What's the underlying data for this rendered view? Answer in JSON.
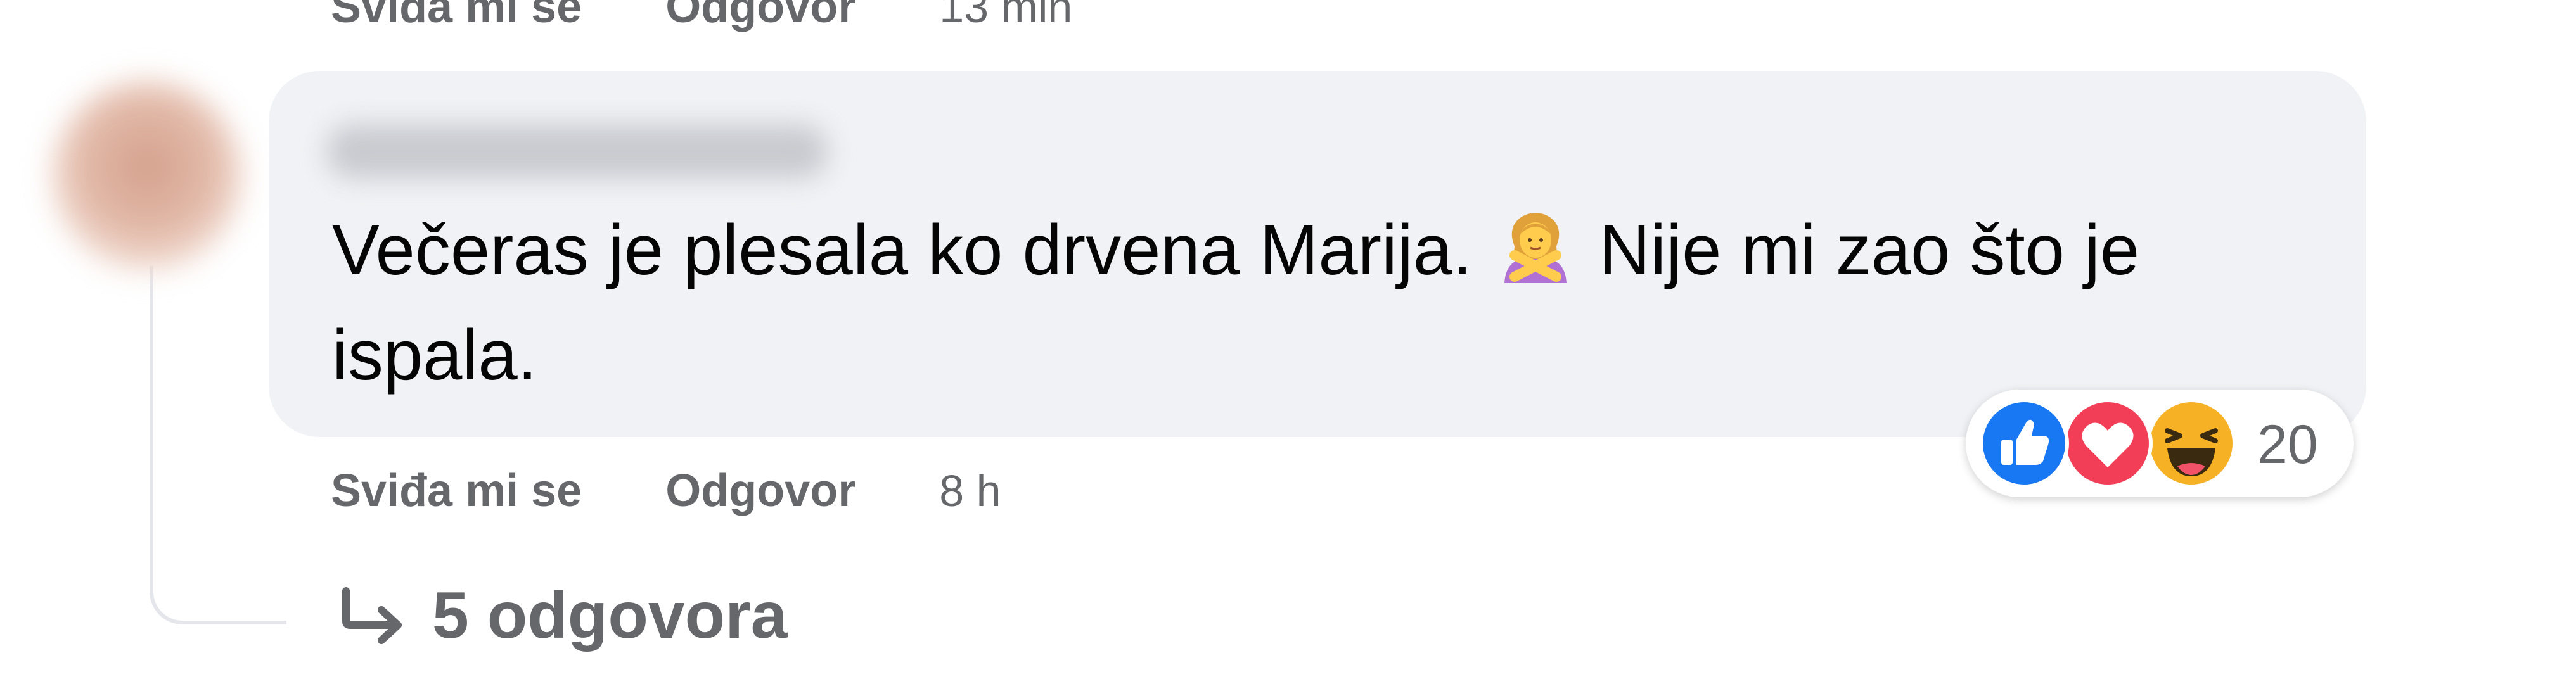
{
  "top_actions": {
    "like_label": "Sviđa mi se",
    "reply_label": "Odgovor",
    "time": "13 min"
  },
  "comment": {
    "text_part1": "Večeras je plesala ko drvena Marija.",
    "emoji_icon": "woman-gesturing-no-icon",
    "text_part2": "Nije mi zao što je ispala."
  },
  "reactions": {
    "icons": [
      "like-icon",
      "love-icon",
      "haha-icon"
    ],
    "count": "20"
  },
  "actions": {
    "like_label": "Sviđa mi se",
    "reply_label": "Odgovor",
    "time": "8 h"
  },
  "replies": {
    "icon": "reply-arrow-icon",
    "label": "5 odgovora"
  },
  "colors": {
    "bubble_bg": "#f0f2f5",
    "secondary_text": "#65676b",
    "like_blue": "#1877f2",
    "love_red": "#f33e58",
    "haha_yellow": "#f7b125"
  }
}
